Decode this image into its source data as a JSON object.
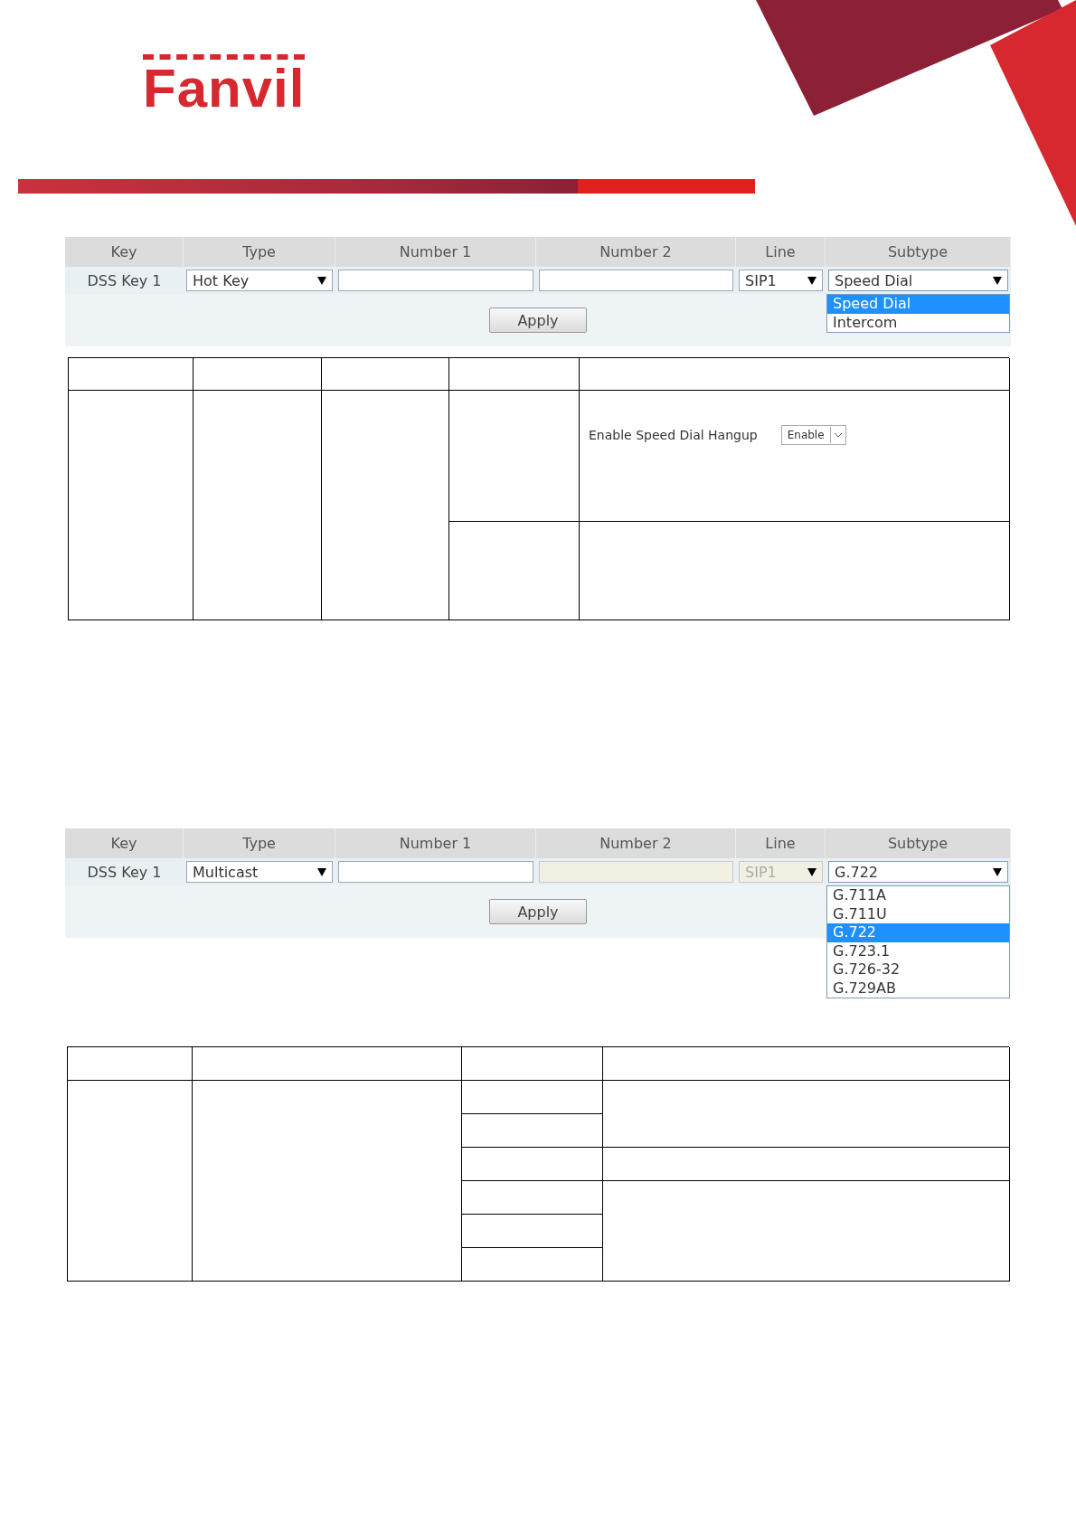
{
  "logo": {
    "text": "Fanvil"
  },
  "screens": [
    {
      "columns": [
        "Key",
        "Type",
        "Number 1",
        "Number 2",
        "Line",
        "Subtype"
      ],
      "key": "DSS Key 1",
      "type": "Hot Key",
      "number_2_disabled": false,
      "line": "SIP1",
      "line_disabled": false,
      "subtype": "Speed Dial",
      "options": [
        {
          "label": "Speed Dial",
          "selected": true
        },
        {
          "label": "Intercom",
          "selected": false
        }
      ],
      "apply": "Apply"
    },
    {
      "columns": [
        "Key",
        "Type",
        "Number 1",
        "Number 2",
        "Line",
        "Subtype"
      ],
      "key": "DSS Key 1",
      "type": "Multicast",
      "number_2_disabled": true,
      "line": "SIP1",
      "line_disabled": true,
      "subtype": "G.722",
      "options": [
        {
          "label": "G.711A",
          "selected": false
        },
        {
          "label": "G.711U",
          "selected": false
        },
        {
          "label": "G.722",
          "selected": true
        },
        {
          "label": "G.723.1",
          "selected": false
        },
        {
          "label": "G.726-32",
          "selected": false
        },
        {
          "label": "G.729AB",
          "selected": false
        }
      ],
      "apply": "Apply"
    }
  ],
  "table_1": {
    "setting": {
      "label": "Enable Speed Dial Hangup",
      "value": "Enable"
    }
  }
}
